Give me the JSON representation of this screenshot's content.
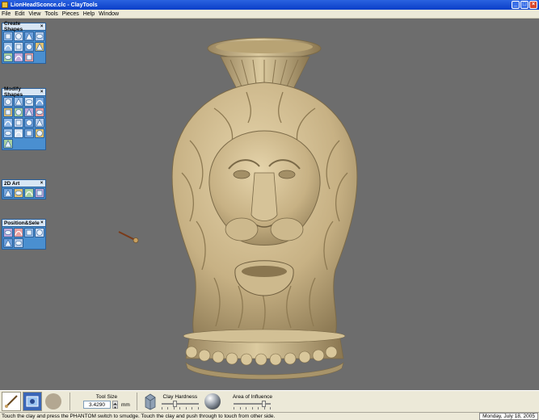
{
  "window": {
    "title": "LionHeadSconce.clc - ClayTools",
    "minimize_glyph": "_",
    "maximize_glyph": "□",
    "close_glyph": "×"
  },
  "menu": [
    "File",
    "Edit",
    "View",
    "Tools",
    "Pieces",
    "Help",
    "Window"
  ],
  "palettes": [
    {
      "title": "Create Shapes",
      "close": "×",
      "tool_count": 11
    },
    {
      "title": "Modify Shapes",
      "close": "×",
      "tool_count": 17
    },
    {
      "title": "2D Art",
      "close": "×",
      "tool_count": 4
    },
    {
      "title": "Position&Sele",
      "close": "×",
      "tool_count": 6
    }
  ],
  "toolbar": {
    "tool_size_label": "Tool Size",
    "tool_size_value": "3.4290",
    "tool_size_unit": "mm",
    "clay_hardness_label": "Clay Hardness",
    "clay_hardness_level": 0.35,
    "area_of_influence_label": "Area of Influence",
    "area_of_influence_level": 0.85
  },
  "status": {
    "message": "Touch the clay and press the PHANTOM switch to smudge. Touch the clay and push through to touch from other side.",
    "date": "Monday, July 18, 2005"
  },
  "colors": {
    "viewport_bg": "#6d6d6d",
    "clay": "#cbb68a",
    "palette_blue": "#4a8fd0",
    "titlebar_blue": "#0a3ec8"
  }
}
